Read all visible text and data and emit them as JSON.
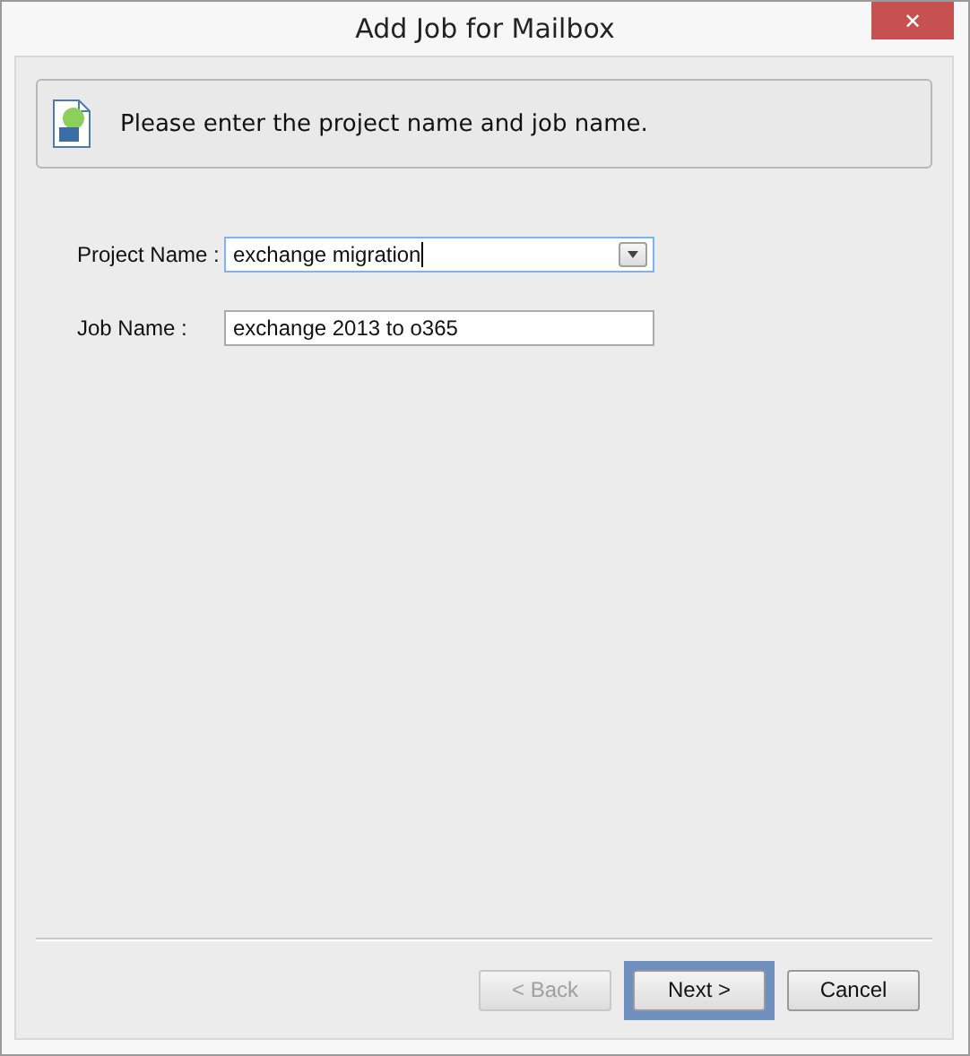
{
  "window": {
    "title": "Add Job for Mailbox",
    "close": "✕"
  },
  "header": {
    "message": "Please enter the project name and job name."
  },
  "fields": [
    {
      "kind": "combo",
      "label": "Project Name :",
      "value": "exchange migration",
      "focused": true
    },
    {
      "kind": "text",
      "label": "Job Name :",
      "value": "exchange 2013 to o365",
      "focused": false
    }
  ],
  "buttons": [
    {
      "label": "< Back",
      "disabled": true,
      "focused": false
    },
    {
      "label": "Next >",
      "disabled": false,
      "focused": true
    },
    {
      "label": "Cancel",
      "disabled": false,
      "focused": false
    }
  ]
}
